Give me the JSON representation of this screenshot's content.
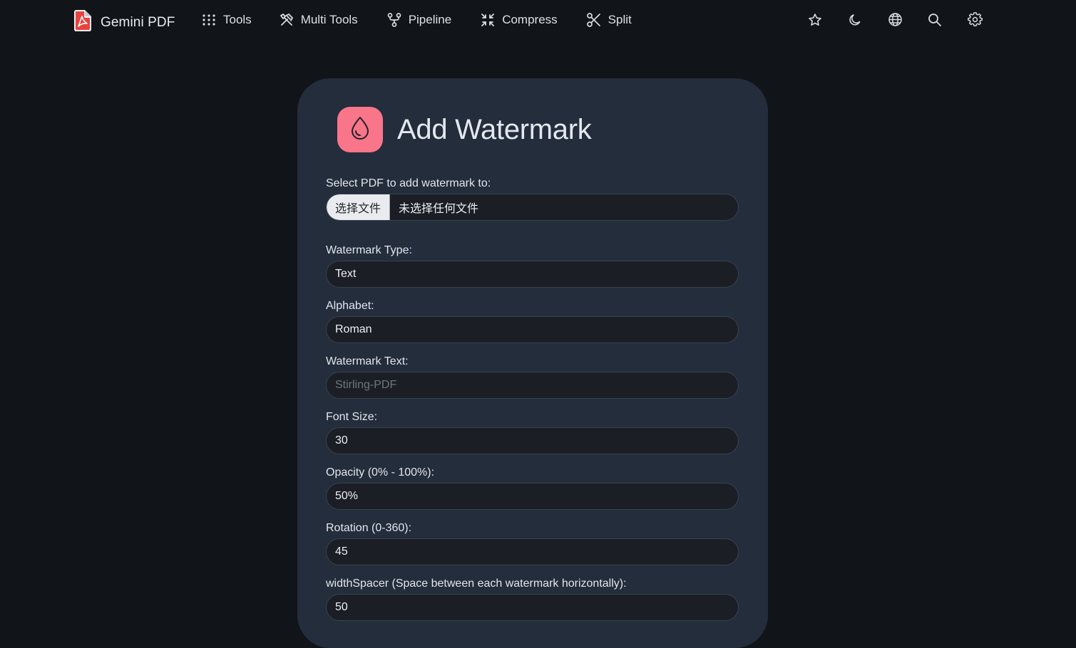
{
  "app": {
    "name": "Gemini PDF"
  },
  "nav": {
    "items": [
      {
        "label": "Tools",
        "icon": "grid-dots-icon"
      },
      {
        "label": "Multi Tools",
        "icon": "tools-icon"
      },
      {
        "label": "Pipeline",
        "icon": "pipeline-icon"
      },
      {
        "label": "Compress",
        "icon": "compress-icon"
      },
      {
        "label": "Split",
        "icon": "scissors-icon"
      }
    ],
    "right_icons": [
      "star-icon",
      "moon-icon",
      "globe-icon",
      "search-icon",
      "gear-icon"
    ]
  },
  "page": {
    "title": "Add Watermark",
    "icon": "droplet-icon",
    "accent_color": "#f9758a"
  },
  "form": {
    "file": {
      "label": "Select PDF to add watermark to:",
      "button": "选择文件",
      "status": "未选择任何文件"
    },
    "watermark_type": {
      "label": "Watermark Type:",
      "value": "Text"
    },
    "alphabet": {
      "label": "Alphabet:",
      "value": "Roman"
    },
    "watermark_text": {
      "label": "Watermark Text:",
      "placeholder": "Stirling-PDF"
    },
    "font_size": {
      "label": "Font Size:",
      "value": "30"
    },
    "opacity": {
      "label": "Opacity (0% - 100%):",
      "value": "50%"
    },
    "rotation": {
      "label": "Rotation (0-360):",
      "value": "45"
    },
    "width_spacer": {
      "label": "widthSpacer (Space between each watermark horizontally):",
      "value": "50"
    }
  }
}
